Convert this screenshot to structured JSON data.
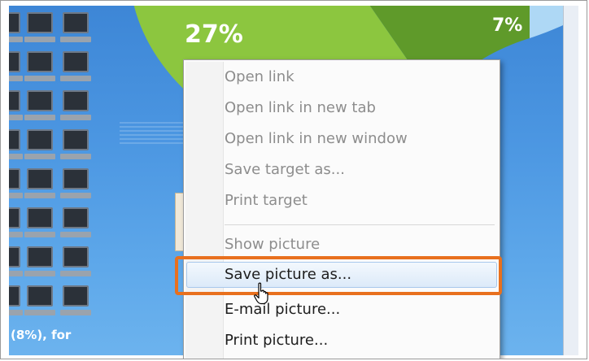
{
  "background": {
    "pie_label_left": "27%",
    "pie_label_right": "7%",
    "bottom_label": "(8%), for",
    "colors": {
      "page_blue": "#4c97e2",
      "pie_green": "#8cc63f",
      "pie_dark_green": "#5f9a2a",
      "pie_light_blue": "#aed8f5"
    }
  },
  "context_menu": {
    "items": [
      {
        "label": "Open link",
        "enabled": false
      },
      {
        "label": "Open link in new tab",
        "enabled": false
      },
      {
        "label": "Open link in new window",
        "enabled": false
      },
      {
        "label": "Save target as...",
        "enabled": false
      },
      {
        "label": "Print target",
        "enabled": false
      },
      {
        "label": "Show picture",
        "enabled": false
      },
      {
        "label": "Save picture as...",
        "enabled": true,
        "hovered": true
      },
      {
        "label": "E-mail picture...",
        "enabled": true
      },
      {
        "label": "Print picture...",
        "enabled": true
      }
    ],
    "highlight_color": "#e8701e"
  },
  "cursor": {
    "icon": "hand-pointer-icon"
  }
}
